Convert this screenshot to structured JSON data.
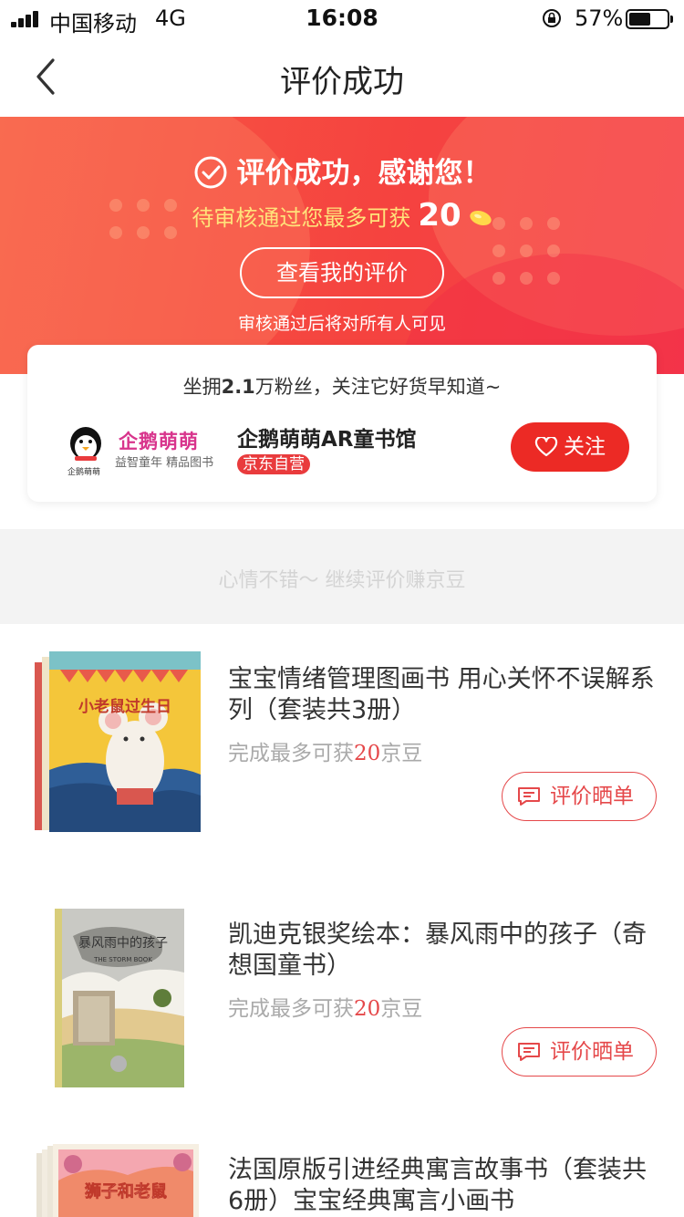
{
  "status_bar": {
    "carrier": "中国移动",
    "network": "4G",
    "time": "16:08",
    "battery_percent": "57%",
    "battery_level": 0.57
  },
  "nav": {
    "title": "评价成功",
    "back_icon": "chevron-left-icon"
  },
  "banner": {
    "success_text": "评价成功，感谢您！",
    "reward_prefix": "待审核通过您最多可获",
    "reward_amount": "20",
    "view_button": "查看我的评价",
    "visibility_note": "审核通过后将对所有人可见",
    "colors": {
      "start": "#f75a45",
      "end": "#f43a4c",
      "reward_text": "#ffe27a"
    }
  },
  "shop": {
    "fans_prefix": "坐拥",
    "fans_count": "2.1",
    "fans_suffix": "万粉丝，关注它好货早知道~",
    "logo_title": "企鹅萌萌",
    "logo_subtitle": "益智童年 精品图书",
    "logo_small": "企鹅萌萌",
    "name": "企鹅萌萌AR童书馆",
    "badge": "京东自营",
    "follow_button": "关注"
  },
  "continue_prompt": "心情不错～ 继续评价赚京豆",
  "products": [
    {
      "title": "宝宝情绪管理图画书 用心关怀不误解系列（套装共3册）",
      "earn_prefix": "完成最多可获",
      "earn_amount": "20",
      "earn_suffix": "京豆",
      "button": "评价晒单",
      "cover_text": "小老鼠过生日"
    },
    {
      "title": "凯迪克银奖绘本：暴风雨中的孩子（奇想国童书）",
      "earn_prefix": "完成最多可获",
      "earn_amount": "20",
      "earn_suffix": "京豆",
      "button": "评价晒单",
      "cover_text": "暴风雨中的孩子",
      "cover_subtext": "THE STORM BOOK"
    },
    {
      "title": "法国原版引进经典寓言故事书（套装共6册）宝宝经典寓言小画书",
      "cover_text": "狮子和老鼠"
    }
  ],
  "colors": {
    "accent_red": "#ec2a25",
    "price_red": "#e5484a"
  }
}
